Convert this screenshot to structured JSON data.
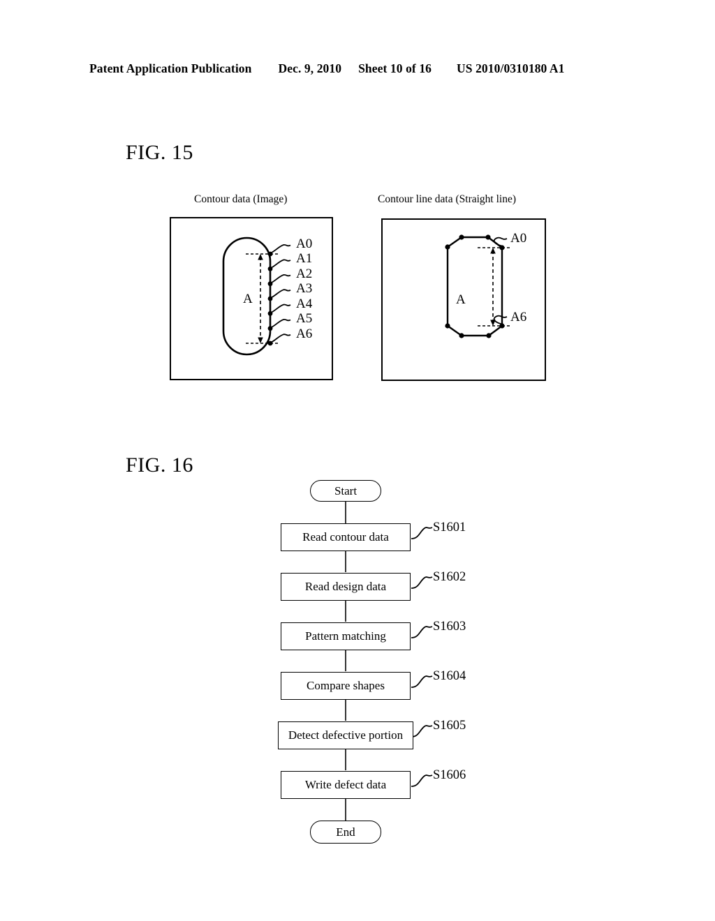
{
  "header": {
    "publication": "Patent Application Publication",
    "date": "Dec. 9, 2010",
    "sheet": "Sheet 10 of 16",
    "number": "US 2010/0310180 A1"
  },
  "figures": [
    {
      "id": "fig15",
      "title": "FIG. 15",
      "panels": [
        {
          "id": "contour-image",
          "caption": "Contour data (Image)",
          "shape": "stadium",
          "dimension_label": "A",
          "point_labels": [
            "A0",
            "A1",
            "A2",
            "A3",
            "A4",
            "A5",
            "A6"
          ]
        },
        {
          "id": "contour-line",
          "caption": "Contour line data (Straight line)",
          "shape": "octagon",
          "dimension_label": "A",
          "point_labels": [
            "A0",
            "A6"
          ]
        }
      ]
    },
    {
      "id": "fig16",
      "title": "FIG. 16",
      "flowchart": {
        "start_label": "Start",
        "end_label": "End",
        "steps": [
          {
            "label": "Read contour data",
            "step": "S1601"
          },
          {
            "label": "Read design data",
            "step": "S1602"
          },
          {
            "label": "Pattern matching",
            "step": "S1603"
          },
          {
            "label": "Compare shapes",
            "step": "S1604"
          },
          {
            "label": "Detect defective portion",
            "step": "S1605"
          },
          {
            "label": "Write defect data",
            "step": "S1606"
          }
        ]
      }
    }
  ],
  "colors": {
    "ink": "#000000",
    "paper": "#ffffff"
  }
}
